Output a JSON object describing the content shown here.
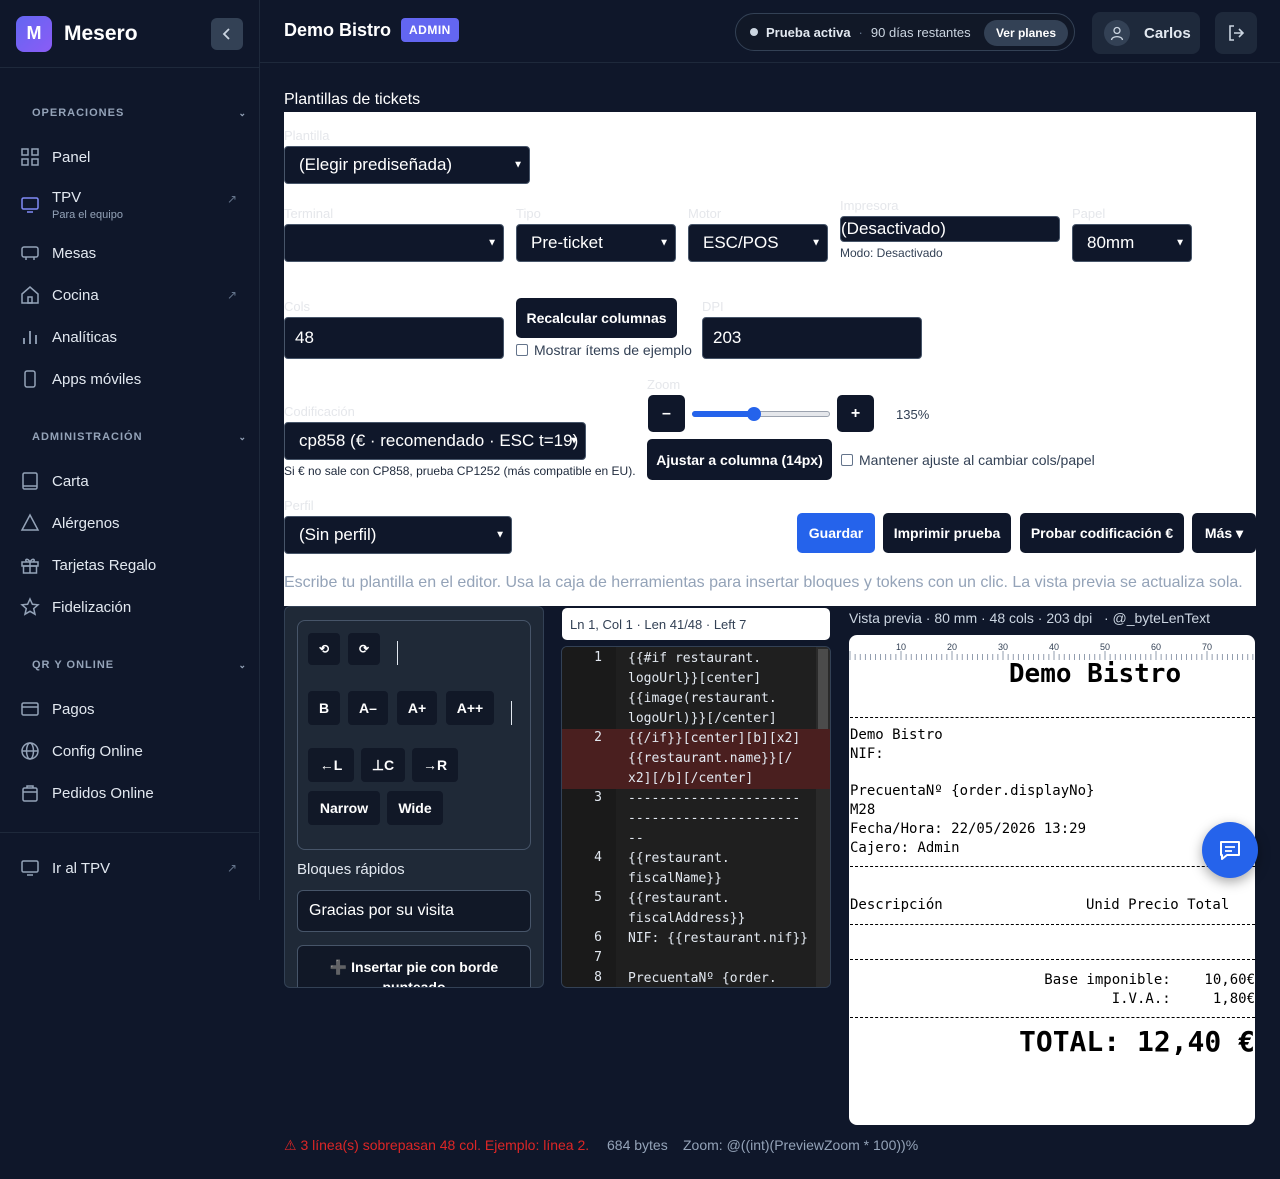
{
  "brand": {
    "logo_letter": "M",
    "name": "Mesero"
  },
  "sidebar": {
    "sections": [
      {
        "title": "OPERACIONES",
        "items": [
          {
            "label": "Panel",
            "icon": "grid-icon"
          },
          {
            "label": "TPV",
            "sub": "Para el equipo",
            "icon": "monitor-icon",
            "external": true
          },
          {
            "label": "Mesas",
            "icon": "table-icon"
          },
          {
            "label": "Cocina",
            "icon": "home-icon",
            "external": true
          },
          {
            "label": "Analíticas",
            "icon": "bar-chart-icon"
          },
          {
            "label": "Apps móviles",
            "icon": "phone-icon"
          }
        ]
      },
      {
        "title": "ADMINISTRACIÓN",
        "items": [
          {
            "label": "Carta",
            "icon": "book-icon"
          },
          {
            "label": "Alérgenos",
            "icon": "warning-icon"
          },
          {
            "label": "Tarjetas Regalo",
            "icon": "gift-icon"
          },
          {
            "label": "Fidelización",
            "icon": "star-icon"
          }
        ]
      },
      {
        "title": "QR Y ONLINE",
        "items": [
          {
            "label": "Pagos",
            "icon": "card-icon"
          },
          {
            "label": "Config Online",
            "icon": "globe-icon"
          },
          {
            "label": "Pedidos Online",
            "icon": "bag-icon"
          }
        ]
      }
    ],
    "footer_item": "Ir al TPV"
  },
  "topbar": {
    "title": "Demo Bistro",
    "badge": "ADMIN",
    "trial_label": "Prueba activa",
    "trial_sep": "·",
    "trial_days": "90 días restantes",
    "plans_button": "Ver planes",
    "user": "Carlos"
  },
  "page": {
    "title": "Plantillas de tickets"
  },
  "form": {
    "plantilla_label": "Plantilla",
    "plantilla_value": "(Elegir prediseñada)",
    "terminal_label": "Terminal",
    "terminal_value": "",
    "tipo_label": "Tipo",
    "tipo_value": "Pre-ticket",
    "motor_label": "Motor",
    "motor_value": "ESC/POS",
    "impresora_label": "Impresora",
    "impresora_value": "(Desactivado)",
    "impresora_mode": "Modo: Desactivado",
    "papel_label": "Papel",
    "papel_value": "80mm",
    "cols_label": "Cols",
    "cols_value": "48",
    "recalc_button": "Recalcular columnas",
    "show_items_label": "Mostrar ítems de ejemplo",
    "dpi_label": "DPI",
    "dpi_value": "203",
    "zoom_label": "Zoom",
    "zoom_minus": "–",
    "zoom_plus": "+",
    "zoom_value": "135%",
    "zoom_fraction": 0.45,
    "codificacion_label": "Codificación",
    "codificacion_value": "cp858 (€ · recomendado · ESC t=19)",
    "codificacion_hint": "Si € no sale con CP858, prueba CP1252 (más compatible en EU).",
    "fit_button": "Ajustar a columna (14px)",
    "keep_fit_label": "Mantener ajuste al cambiar cols/papel",
    "perfil_label": "Perfil",
    "perfil_value": "(Sin perfil)",
    "save_button": "Guardar",
    "print_button": "Imprimir prueba",
    "test_button": "Probar codificación €",
    "more_button": "Más ▾",
    "hint": "Escribe tu plantilla en el editor. Usa la caja de herramientas para insertar bloques y tokens con un clic. La vista previa se actualiza sola."
  },
  "toolbox": {
    "undo": "⟲",
    "redo": "⟳",
    "bold": "B",
    "a_minus": "A–",
    "a_plus": "A+",
    "a_plus_plus": "A++",
    "align_left": "←L",
    "align_center": "⊥C",
    "align_right": "→R",
    "narrow": "Narrow",
    "wide": "Wide",
    "quick_blocks_label": "Bloques rápidos",
    "quick_block_value": "Gracias por su visita",
    "insert_footer": "➕ Insertar pie con borde punteado"
  },
  "editor": {
    "status": "Ln 1, Col 1 · Len 41/48 · Left 7",
    "lines": [
      {
        "n": "1",
        "text": "{{#if restaurant.\nlogoUrl}}[center]\n{{image(restaurant.\nlogoUrl)}}[/center]",
        "error": false
      },
      {
        "n": "2",
        "text": "{{/if}}[center][b][x2]\n{{restaurant.name}}[/\nx2][/b][/center]",
        "error": true
      },
      {
        "n": "3",
        "text": "----------------------\n----------------------\n--",
        "error": false
      },
      {
        "n": "4",
        "text": "{{restaurant.\nfiscalName}}",
        "error": false
      },
      {
        "n": "5",
        "text": "{{restaurant.\nfiscalAddress}}",
        "error": false
      },
      {
        "n": "6",
        "text": "NIF: {{restaurant.nif}}",
        "error": false
      },
      {
        "n": "7",
        "text": "",
        "error": false
      },
      {
        "n": "8",
        "text": "PrecuentaNº {order.",
        "error": false
      }
    ]
  },
  "preview": {
    "header": "Vista previa · 80 mm · 48 cols · 203 dpi   · @_byteLenText",
    "ruler_labels": [
      "10",
      "20",
      "30",
      "40",
      "50",
      "60",
      "70"
    ],
    "title": "Demo Bistro",
    "lines": [
      "Demo Bistro",
      "NIF:",
      "PrecuentaNº {order.displayNo}",
      "M28",
      "Fecha/Hora: 22/05/2026 13:29",
      "Cajero: Admin"
    ],
    "columns": "Descripción                 Unid Precio Total",
    "base": "Base imponible:    10,60€",
    "iva": "I.V.A.:     1,80€",
    "total": "TOTAL: 12,40 €"
  },
  "status": {
    "warning": "⚠ 3 línea(s) sobrepasan 48 col. Ejemplo: línea 2.",
    "bytes": "684 bytes",
    "zoom": "Zoom: @((int)(PreviewZoom * 100))%"
  },
  "colors": {
    "accent": "#2563eb",
    "brand": "#6366f1",
    "error": "#dc2626",
    "bg": "#0f172a"
  }
}
